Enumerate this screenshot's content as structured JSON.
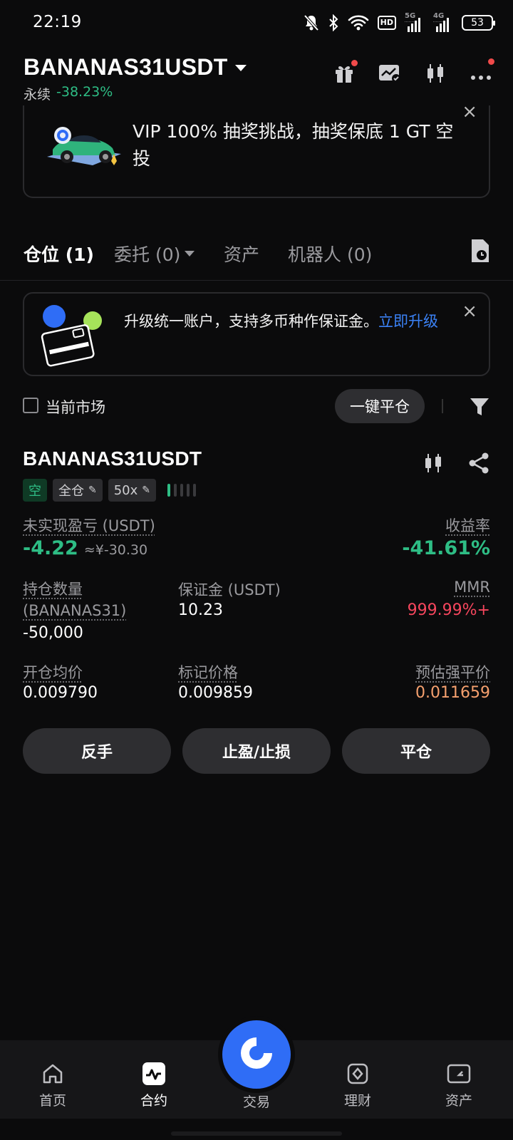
{
  "status_bar": {
    "time": "22:19",
    "hd_label": "HD",
    "net1_label": "5G",
    "net2_label": "4G",
    "battery": "53",
    "icons": [
      "mute-icon",
      "bluetooth-icon",
      "wifi-icon",
      "hd-icon",
      "signal-5g-icon",
      "signal-4g-icon",
      "battery-icon"
    ]
  },
  "header": {
    "symbol": "BANANAS31USDT",
    "type_label": "永续",
    "change": "-38.23%",
    "icons": [
      "gift-icon",
      "chart-check-icon",
      "candlestick-icon",
      "more-icon"
    ]
  },
  "promo": {
    "text": "VIP 100% 抽奖挑战，抽奖保底 1 GT 空投",
    "close": "×"
  },
  "tabs": [
    {
      "label": "仓位 (1)",
      "active": true
    },
    {
      "label": "委托 (0)",
      "active": false
    },
    {
      "label": "资产",
      "active": false
    },
    {
      "label": "机器人 (0)",
      "active": false
    }
  ],
  "upgrade": {
    "text": "升级统一账户，支持多币种作保证金。",
    "link": "立即升级",
    "close": "×"
  },
  "filter": {
    "current_market_label": "当前市场",
    "close_all_label": "一键平仓"
  },
  "position": {
    "symbol": "BANANAS31USDT",
    "side_tag": "空",
    "margin_mode_tag": "全仓",
    "leverage_tag": "50x",
    "risk_level": 1,
    "risk_level_max": 5,
    "unrealized_pnl_label": "未实现盈亏 (USDT)",
    "unrealized_pnl": "-4.22",
    "unrealized_pnl_cny": "≈¥-30.30",
    "roe_label": "收益率",
    "roe": "-41.61%",
    "qty_label_line1": "持仓数量",
    "qty_label_line2": "(BANANAS31)",
    "qty": "-50,000",
    "margin_label": "保证金 (USDT)",
    "margin": "10.23",
    "mmr_label": "MMR",
    "mmr": "999.99%+",
    "entry_label": "开仓均价",
    "entry": "0.009790",
    "mark_label": "标记价格",
    "mark": "0.009859",
    "liq_label": "预估强平价",
    "liq": "0.011659",
    "actions": [
      "反手",
      "止盈/止损",
      "平仓"
    ]
  },
  "bottom_nav": {
    "items": [
      {
        "label": "首页",
        "icon": "home-icon"
      },
      {
        "label": "合约",
        "icon": "futures-icon"
      },
      {
        "label": "交易",
        "icon": "trade-icon"
      },
      {
        "label": "理财",
        "icon": "earn-icon"
      },
      {
        "label": "资产",
        "icon": "wallet-icon"
      }
    ],
    "active": "合约"
  },
  "colors": {
    "green": "#2ebd85",
    "red": "#f6465d",
    "orange": "#f5a06e",
    "brand_blue": "#2f6df6",
    "link_blue": "#3b82f6"
  }
}
